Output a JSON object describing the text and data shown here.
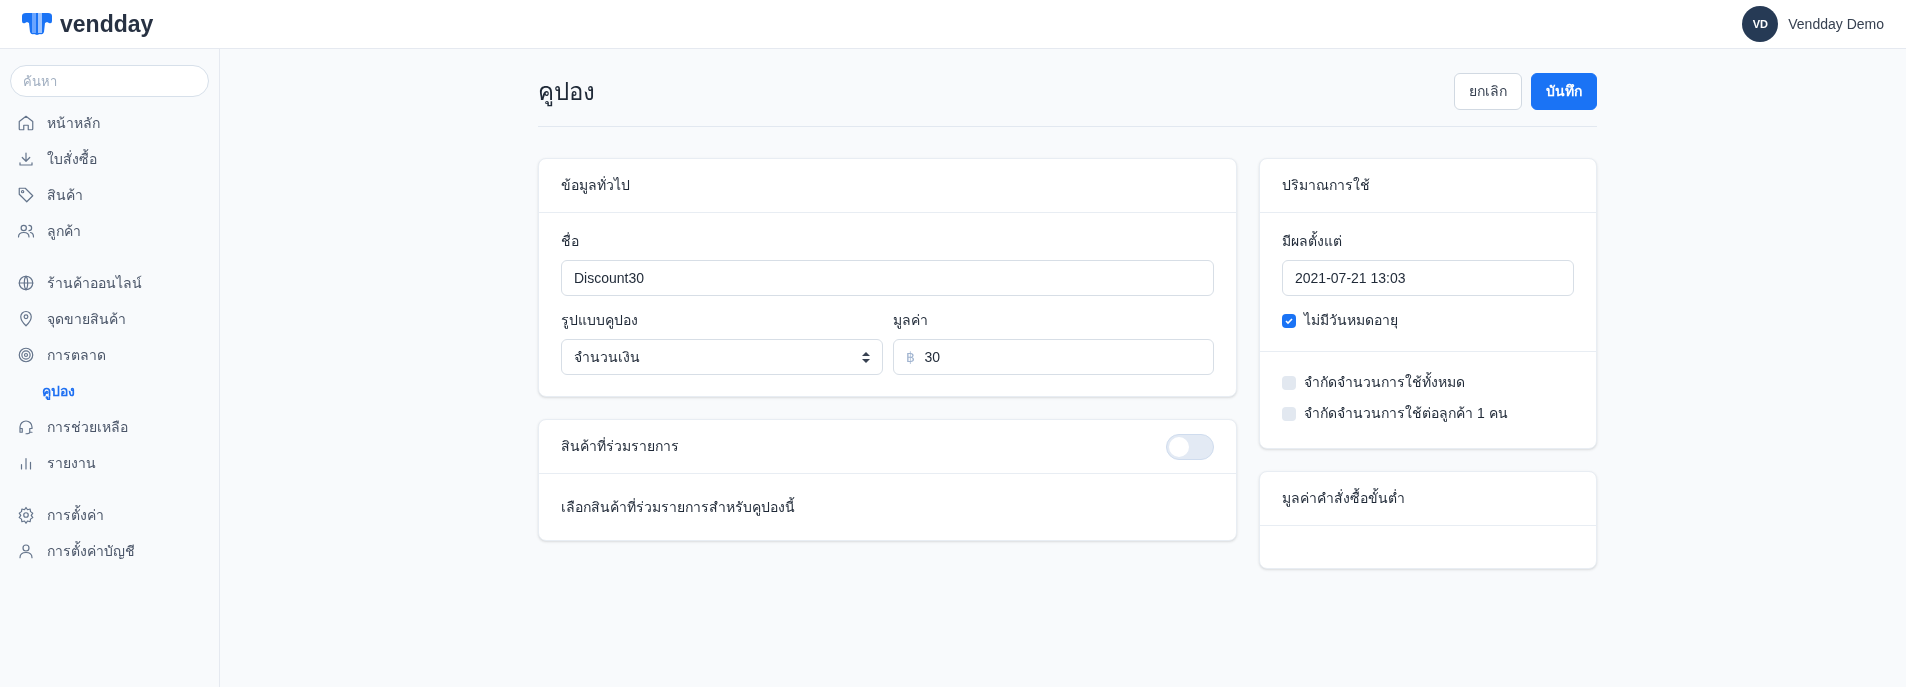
{
  "header": {
    "brand": "vendday",
    "user": {
      "initials": "VD",
      "name": "Vendday Demo"
    }
  },
  "sidebar": {
    "search": {
      "placeholder": "ค้นหา"
    },
    "groups": [
      [
        {
          "label": "หน้าหลัก",
          "kind": "home",
          "selected": false
        },
        {
          "label": "ใบสั่งซื้อ",
          "kind": "download",
          "selected": false
        },
        {
          "label": "สินค้า",
          "kind": "tag",
          "selected": false
        },
        {
          "label": "ลูกค้า",
          "kind": "users",
          "selected": false
        }
      ],
      [
        {
          "label": "ร้านค้าออนไลน์",
          "kind": "globe",
          "selected": false
        },
        {
          "label": "จุดขายสินค้า",
          "kind": "pin",
          "selected": false
        },
        {
          "label": "การตลาด",
          "kind": "target",
          "selected": false,
          "children": [
            {
              "label": "คูปอง",
              "selected": true
            }
          ]
        },
        {
          "label": "การช่วยเหลือ",
          "kind": "headset",
          "selected": false
        },
        {
          "label": "รายงาน",
          "kind": "bars",
          "selected": false
        }
      ],
      [
        {
          "label": "การตั้งค่า",
          "kind": "gear",
          "selected": false
        },
        {
          "label": "การตั้งค่าบัญชี",
          "kind": "user",
          "selected": false
        }
      ]
    ]
  },
  "page": {
    "title": "คูปอง",
    "buttons": [
      {
        "label": "ยกเลิก",
        "kind": "secondary"
      },
      {
        "label": "บันทึก",
        "kind": "primary"
      }
    ]
  },
  "general": {
    "title": "ข้อมูลทั่วไป",
    "name_label": "ชื่อ",
    "name_value": "Discount30",
    "type_label": "รูปแบบคูปอง",
    "type_value": "จำนวนเงิน",
    "value_label": "มูลค่า",
    "currency": "฿",
    "value": "30"
  },
  "products": {
    "title": "สินค้าที่ร่วมรายการ",
    "on": false,
    "hint": "เลือกสินค้าที่ร่วมรายการสำหรับคูปองนี้"
  },
  "usage": {
    "title": "ปริมาณการใช้",
    "start_label": "มีผลตั้งแต่",
    "start_value": "2021-07-21 13:03",
    "no_expiry": {
      "label": "ไม่มีวันหมดอายุ",
      "checked": true
    },
    "limits": [
      {
        "label": "จำกัดจำนวนการใช้ทั้งหมด",
        "checked": false
      },
      {
        "label": "จำกัดจำนวนการใช้ต่อลูกค้า 1 คน",
        "checked": false
      }
    ]
  },
  "minimum": {
    "title": "มูลค่าคำสั่งซื้อขั้นต่ำ"
  }
}
